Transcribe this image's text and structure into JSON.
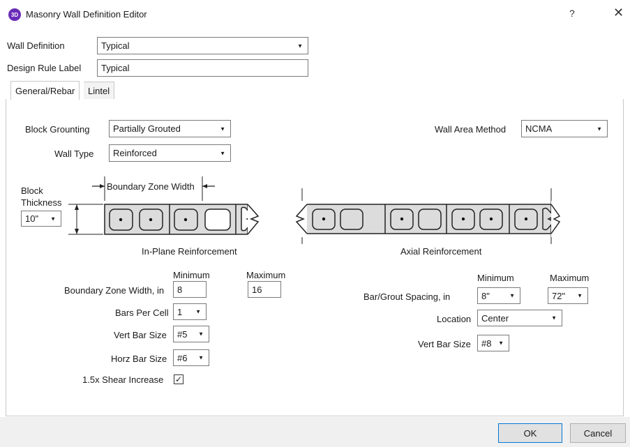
{
  "window": {
    "icon_text": "3D",
    "title": "Masonry Wall Definition Editor",
    "help_label": "?",
    "close_label": "✕"
  },
  "header": {
    "wall_definition_label": "Wall Definition",
    "wall_definition_value": "Typical",
    "design_rule_label": "Design Rule Label",
    "design_rule_value": "Typical"
  },
  "tabs": [
    {
      "label": "General/Rebar",
      "active": true
    },
    {
      "label": "Lintel",
      "active": false
    }
  ],
  "general": {
    "block_grouting_label": "Block Grounting",
    "block_grouting_value": "Partially Grouted",
    "wall_type_label": "Wall Type",
    "wall_type_value": "Reinforced",
    "wall_area_method_label": "Wall Area Method",
    "wall_area_method_value": "NCMA",
    "block_thickness_label_1": "Block",
    "block_thickness_label_2": "Thickness",
    "block_thickness_value": "10\"",
    "boundary_zone_width_label": "Boundary Zone Width",
    "in_plane_title": "In-Plane Reinforcement",
    "axial_title": "Axial Reinforcement"
  },
  "in_plane": {
    "minimum_header": "Minimum",
    "maximum_header": "Maximum",
    "boundary_zone_width_label": "Boundary Zone Width, in",
    "boundary_zone_min": "8",
    "boundary_zone_max": "16",
    "bars_per_cell_label": "Bars Per Cell",
    "bars_per_cell_value": "1",
    "vert_bar_size_label": "Vert Bar Size",
    "vert_bar_size_value": "#5",
    "horz_bar_size_label": "Horz Bar Size",
    "horz_bar_size_value": "#6",
    "shear_increase_label": "1.5x Shear Increase",
    "shear_increase_checked": true,
    "check_glyph": "✓"
  },
  "axial": {
    "minimum_header": "Minimum",
    "maximum_header": "Maximum",
    "bar_grout_spacing_label": "Bar/Grout Spacing, in",
    "spacing_min": "8\"",
    "spacing_max": "72\"",
    "location_label": "Location",
    "location_value": "Center",
    "vert_bar_size_label": "Vert Bar Size",
    "vert_bar_size_value": "#8"
  },
  "footer": {
    "ok_label": "OK",
    "cancel_label": "Cancel"
  },
  "icons": {
    "caret": "▼"
  },
  "colors": {
    "app_icon": "#6a2bb8",
    "focus_border": "#0078d7",
    "diagram_block_fill": "#dcdcdc",
    "diagram_stroke": "#222222"
  }
}
